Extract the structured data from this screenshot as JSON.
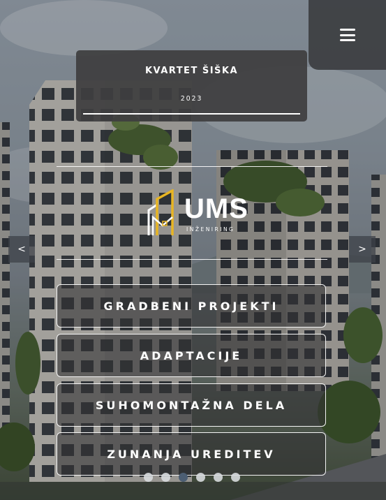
{
  "nav": {
    "menu_icon": "hamburger-icon"
  },
  "project": {
    "title": "KVARTET ŠIŠKA",
    "year": "2023"
  },
  "logo": {
    "brand": "UMS",
    "subtitle": "INŽENIRING",
    "accent_color": "#e8b523"
  },
  "carousel": {
    "prev_label": "<",
    "next_label": ">",
    "slide_count": 6,
    "active_slide": 3
  },
  "services": [
    {
      "label": "GRADBENI PROJEKTI"
    },
    {
      "label": "ADAPTACIJE"
    },
    {
      "label": "SUHOMONTAŽNA DELA"
    },
    {
      "label": "ZUNANJA UREDITEV"
    }
  ]
}
